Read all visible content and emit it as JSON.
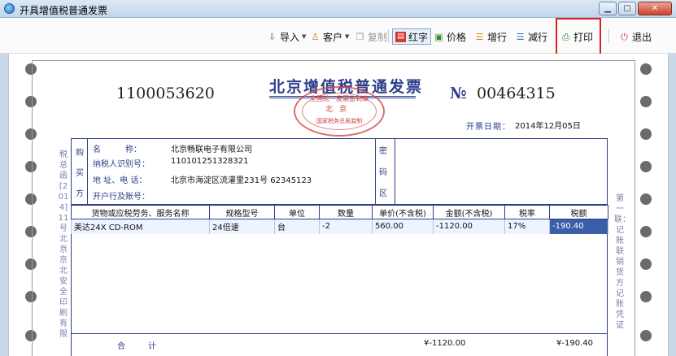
{
  "window": {
    "title": "开具增值税普通发票",
    "minimize_glyph": "▁",
    "maximize_glyph": "▢",
    "close_glyph": "✕"
  },
  "toolbar": {
    "import": "导入",
    "customer": "客户",
    "copy": "复制",
    "red": "红字",
    "price": "价格",
    "add_row": "增行",
    "del_row": "减行",
    "print": "打印",
    "exit": "退出"
  },
  "invoice": {
    "code": "1100053620",
    "title": "北京增值税普通发票",
    "no_symbol": "№",
    "number": "00464315",
    "date_label": "开票日期：",
    "date": "2014年12月05日",
    "seal": {
      "top": "全国统一发票监制章",
      "middle": "北京",
      "bottom": "国家税务总局监制"
    },
    "left_vertical": "税总函[2014]11号北京京北安全印刷有限",
    "right_vertical": "第一联：记账联 销货方记账凭证",
    "buyer_side": [
      "购",
      "买",
      "方"
    ],
    "cipher_side": [
      "密",
      "码",
      "区"
    ],
    "buyer": {
      "name_label": "名　　　称：",
      "name": "北京畅联电子有限公司",
      "taxid_label": "纳税人识别号：",
      "taxid": "110101251328321",
      "address_label": "地 址、电 话：",
      "address": "北京市海淀区流灌里231号 62345123",
      "bank_label": "开户行及账号："
    },
    "columns": [
      "货物或应税劳务、服务名称",
      "规格型号",
      "单位",
      "数量",
      "单价(不含税)",
      "金额(不含税)",
      "税率",
      "税额"
    ],
    "rows": [
      [
        "美达24X CD-ROM",
        "24倍速",
        "台",
        "-2",
        "560.00",
        "-1120.00",
        "17%",
        "-190.40"
      ]
    ],
    "total_label": "合计",
    "total_amount": "¥-1120.00",
    "total_tax": "¥-190.40"
  }
}
